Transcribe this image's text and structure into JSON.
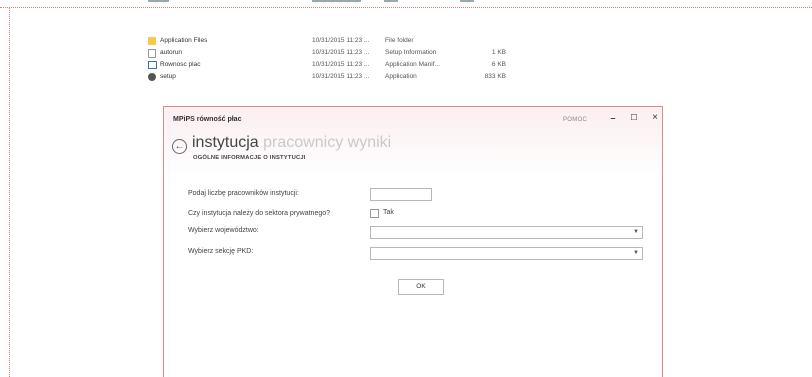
{
  "explorer": {
    "files": [
      {
        "name": "Application Files",
        "date": "10/31/2015 11:23 ...",
        "type": "File folder",
        "size": "",
        "icon": "folder-icon"
      },
      {
        "name": "autorun",
        "date": "10/31/2015 11:23 ...",
        "type": "Setup Information",
        "size": "1 KB",
        "icon": "document-icon"
      },
      {
        "name": "Rownosc plac",
        "date": "10/31/2015 11:23 ...",
        "type": "Application Manif...",
        "size": "6 KB",
        "icon": "application-icon"
      },
      {
        "name": "setup",
        "date": "10/31/2015 11:23 ...",
        "type": "Application",
        "size": "833 KB",
        "icon": "setup-icon"
      }
    ]
  },
  "dialog": {
    "title": "MPiPS równość płac",
    "help": "POMOC",
    "nav": {
      "current": "instytucja",
      "next1": "pracownicy",
      "next2": "wyniki"
    },
    "subtitle": "OGÓLNE INFORMACJE O INSTYTUCJI",
    "fields": {
      "employees_label": "Podaj liczbę pracowników instytucji:",
      "employees_value": "",
      "private_label": "Czy instytucja należy do sektora prywatnego?",
      "private_checkbox_label": "Tak",
      "voivodeship_label": "Wybierz województwo:",
      "voivodeship_value": "",
      "pkd_label": "Wybierz sekcję PKD:",
      "pkd_value": ""
    },
    "ok_label": "OK"
  }
}
